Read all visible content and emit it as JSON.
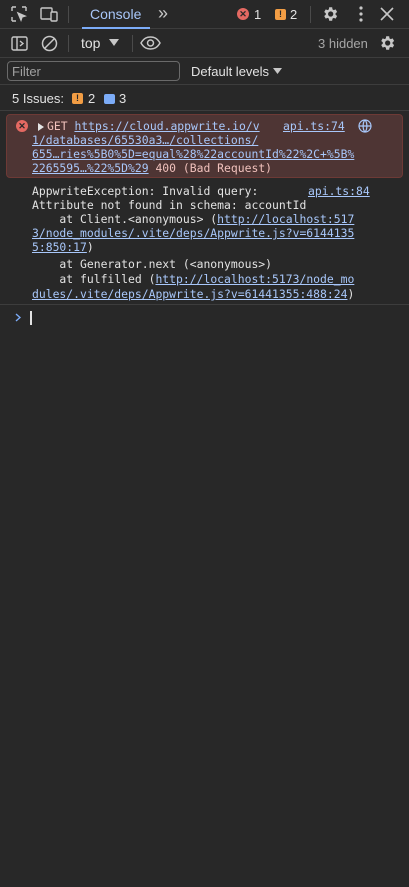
{
  "tabbar": {
    "active_tab": "Console",
    "more_tabs": "»",
    "error_count": "1",
    "warning_count": "2"
  },
  "toolbar": {
    "context": "top",
    "hidden": "3 hidden"
  },
  "filter": {
    "placeholder": "Filter",
    "levels": "Default levels"
  },
  "issues": {
    "label": "5 Issues:",
    "warnings": "2",
    "info": "3"
  },
  "error_entry": {
    "method": "GET",
    "url_line1": "https://cloud.appwrite.io/v",
    "url_line2": "1/databases/65530a3…/collections/",
    "url_line3": "655…ries%5B0%5D=equal%28%22accountId%22%2C+%5B%",
    "url_line4": "2265595…%22%5D%29",
    "status": " 400 (Bad Request)",
    "source": "api.ts:74"
  },
  "log_entry": {
    "line1": "AppwriteException: Invalid query:",
    "line2": "Attribute not found in schema: accountId",
    "line3_prefix": "    at Client.<anonymous> (",
    "line3_link": "http://localhost:517",
    "line4_link": "3/node_modules/.vite/deps/Appwrite.js?v=6144135",
    "line5_link": "5:850:17",
    "line5_suffix": ")",
    "line6": "    at Generator.next (<anonymous>)",
    "line7_prefix": "    at fulfilled (",
    "line7_link": "http://localhost:5173/node_mo",
    "line8_link": "dules/.vite/deps/Appwrite.js?v=61441355:488:24",
    "line8_suffix": ")",
    "source": "api.ts:84"
  },
  "colors": {
    "background": "#282828",
    "accent": "#a8c7fa",
    "error": "#e46962",
    "warning": "#f29d44"
  }
}
